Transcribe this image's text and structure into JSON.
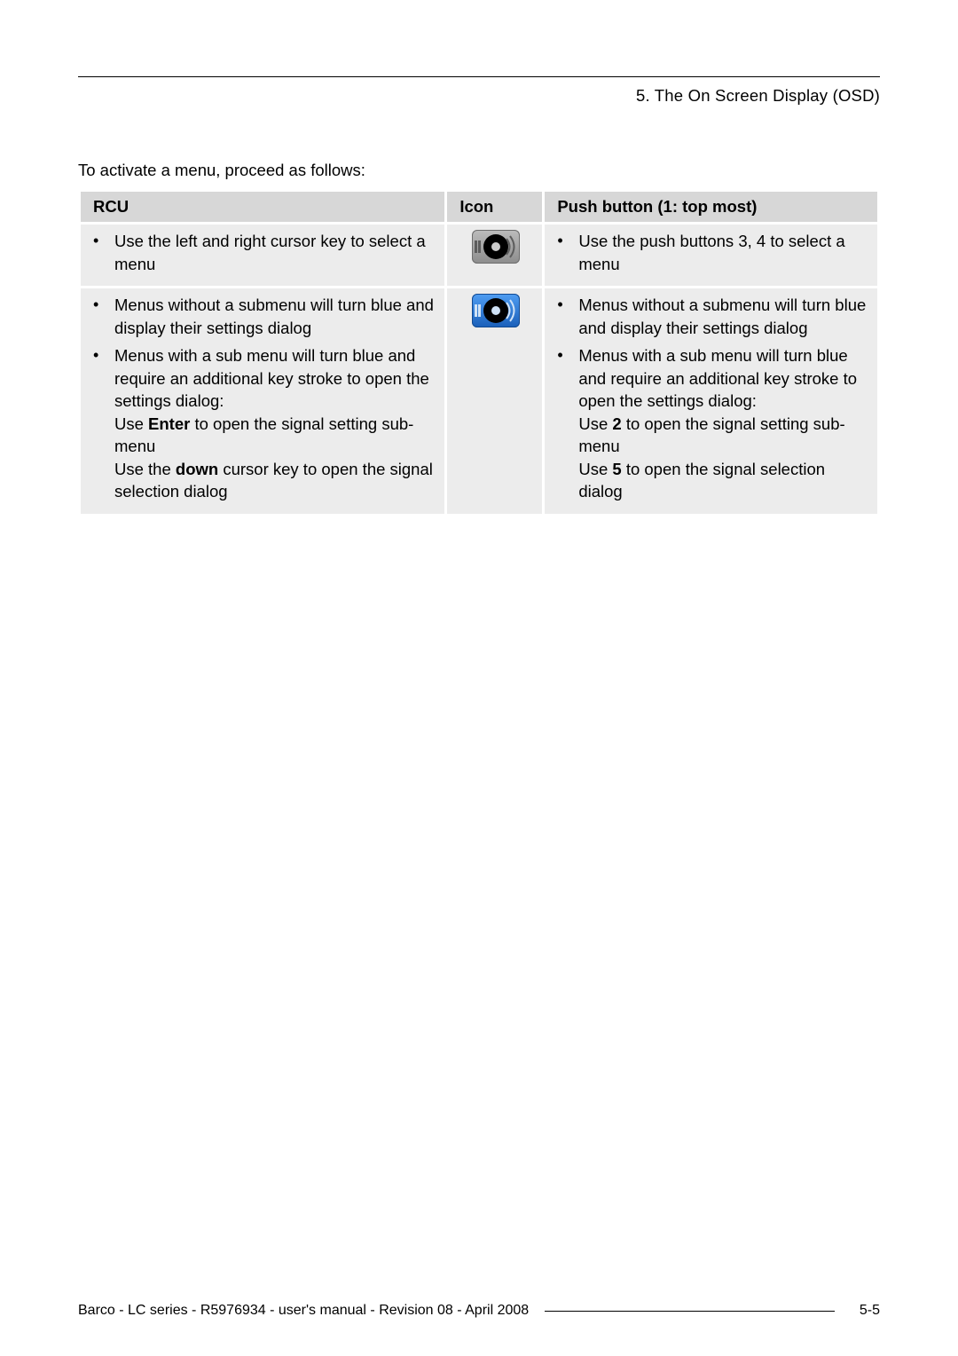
{
  "header": {
    "section_title": "5. The On Screen Display (OSD)"
  },
  "intro": "To activate a menu, proceed as follows:",
  "table": {
    "headers": {
      "rcu": "RCU",
      "icon": "Icon",
      "push": "Push button (1: top most)"
    },
    "row1": {
      "rcu_item": "Use the left and right cursor key to select a menu",
      "push_item": "Use the push buttons 3, 4 to select a menu",
      "icon_name": "remote-icon-grey"
    },
    "row2": {
      "rcu_item1": "Menus without a submenu will turn blue and display their settings dialog",
      "rcu_item2_a": "Menus with a sub menu will turn blue and require an additional key stroke to open the settings dialog:",
      "rcu_item2_b_pre": "Use ",
      "rcu_item2_b_bold": "Enter",
      "rcu_item2_b_post": " to open the signal setting sub-menu",
      "rcu_item2_c_pre": "Use the ",
      "rcu_item2_c_bold": "down",
      "rcu_item2_c_post": " cursor key to open the signal selection dialog",
      "push_item1": "Menus without a submenu will turn blue and display their settings dialog",
      "push_item2_a": "Menus with a sub menu will turn blue and require an additional key stroke to open the settings dialog:",
      "push_item2_b_pre": "Use ",
      "push_item2_b_bold": "2",
      "push_item2_b_post": " to open the signal setting sub-menu",
      "push_item2_c_pre": "Use ",
      "push_item2_c_bold": "5",
      "push_item2_c_post": " to open the signal selection dialog",
      "icon_name": "remote-icon-blue"
    }
  },
  "footer": {
    "left": "Barco - LC series - R5976934 - user's manual - Revision 08 - April 2008",
    "right": "5-5"
  }
}
